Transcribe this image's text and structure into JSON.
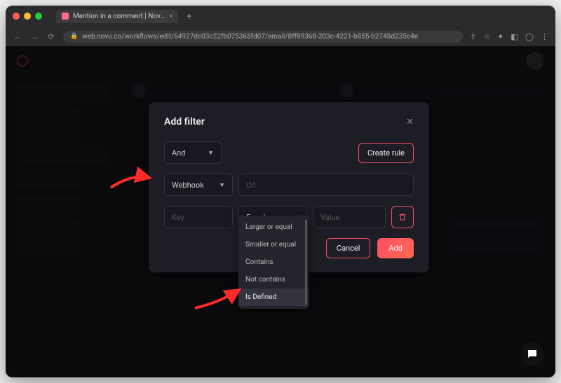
{
  "browser": {
    "tab_title": "Mention in a comment | Nov…",
    "url": "web.novu.co/workflows/edit/64927dc03c22fb075365fd07/email/8ff89368-203c-4221-b855-b2748d235c4e"
  },
  "modal": {
    "title": "Add filter",
    "combinator": {
      "selected": "And"
    },
    "create_rule_label": "Create rule",
    "on_select": {
      "selected": "Webhook"
    },
    "url_placeholder": "Url",
    "key_placeholder": "Key",
    "operator": {
      "selected": "Equal",
      "options": [
        "Larger or equal",
        "Smaller or equal",
        "Contains",
        "Not contains",
        "Is Defined"
      ]
    },
    "value_placeholder": "Value",
    "cancel_label": "Cancel",
    "add_label": "Add"
  },
  "colors": {
    "accent": "#ff4d6a"
  }
}
